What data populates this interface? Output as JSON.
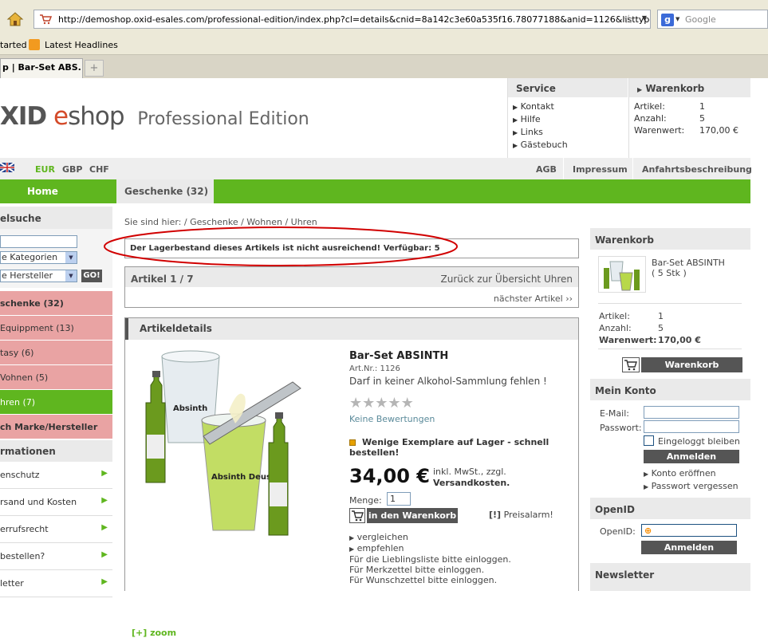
{
  "browser": {
    "url": "http://demoshop.oxid-esales.com/professional-edition/index.php?cl=details&cnid=8a142c3e60a535f16.78077188&anid=1126&listtype=list&&",
    "search_placeholder": "Google",
    "bookmarks": [
      "tarted",
      "Latest Headlines"
    ],
    "tab_title": "p | Bar-Set ABS...",
    "new_tab": "+"
  },
  "header": {
    "logo_oxid": "XID",
    "logo_e": "e",
    "logo_shop": "shop",
    "edition": "Professional Edition",
    "service": {
      "title": "Service",
      "links": [
        "Kontakt",
        "Hilfe",
        "Links",
        "Gästebuch"
      ]
    },
    "cart_top": {
      "title": "Warenkorb",
      "rows": [
        {
          "label": "Artikel:",
          "value": "1"
        },
        {
          "label": "Anzahl:",
          "value": "5"
        },
        {
          "label": "Warenwert:",
          "value": "170,00 €"
        }
      ]
    },
    "currencies": [
      "EUR",
      "GBP",
      "CHF"
    ],
    "toplinks": [
      "AGB",
      "Impressum",
      "Anfahrtsbeschreibung"
    ]
  },
  "nav": {
    "home": "Home",
    "active_category": "Geschenke (32)"
  },
  "sidebar": {
    "search_title": "elsuche",
    "category_select": "e Kategorien",
    "vendor_select": "e Hersteller",
    "go": "GO!",
    "categories": [
      "schenke (32)",
      "Equippment (13)",
      "tasy (6)",
      "Vohnen (5)",
      "hren (7)",
      "ch Marke/Hersteller"
    ],
    "info_title": "rmationen",
    "info_links": [
      "enschutz",
      "rsand und Kosten",
      "errufsrecht",
      "bestellen?",
      "letter"
    ]
  },
  "breadcrumb": {
    "prefix": "Sie sind hier:",
    "trail": "/ Geschenke / Wohnen / Uhren"
  },
  "notice": "Der Lagerbestand dieses Artikels ist nicht ausreichend! Verfügbar: 5",
  "pager": {
    "position": "Artikel 1 / 7",
    "back": "Zurück zur Übersicht Uhren",
    "next": "nächster Artikel"
  },
  "details": {
    "title": "Artikeldetails",
    "product_name": "Bar-Set ABSINTH",
    "art_nr": "Art.Nr.: 1126",
    "short_desc": "Darf in keiner Alkohol-Sammlung fehlen !",
    "stars_filled": 0,
    "stars_total": 5,
    "reviews": "Keine Bewertungen",
    "stock_msg": "Wenige Exemplare auf Lager - schnell bestellen!",
    "price": "34,00 €",
    "tax_note": "inkl. MwSt., zzgl.",
    "shipping": "Versandkosten.",
    "qty_label": "Menge:",
    "qty_value": "1",
    "add_to_cart": "in den Warenkorb",
    "price_alarm_tag": "[!]",
    "price_alarm": "Preisalarm!",
    "zoom": "[+] zoom",
    "compare": "vergleichen",
    "recommend": "empfehlen",
    "login_notes": [
      "Für die Lieblingsliste bitte einloggen.",
      "Für Merkzettel bitte einloggen.",
      "Für Wunschzettel bitte einloggen."
    ],
    "image_labels": [
      "Absinth",
      "Absinth Deus"
    ]
  },
  "right": {
    "cart": {
      "title": "Warenkorb",
      "item_name": "Bar-Set ABSINTH",
      "item_qty": "( 5 Stk )",
      "rows": [
        {
          "label": "Artikel:",
          "value": "1"
        },
        {
          "label": "Anzahl:",
          "value": "5"
        },
        {
          "label": "Warenwert:",
          "value": "170,00 €"
        }
      ],
      "show_button": "Warenkorb anzeigen"
    },
    "account": {
      "title": "Mein Konto",
      "email_label": "E-Mail:",
      "password_label": "Passwort:",
      "remember": "Eingeloggt bleiben",
      "login_button": "Anmelden",
      "links": [
        "Konto eröffnen",
        "Passwort vergessen"
      ]
    },
    "openid": {
      "title": "OpenID",
      "label": "OpenID:",
      "button": "Anmelden"
    },
    "newsletter": {
      "title": "Newsletter"
    }
  },
  "colors": {
    "accent": "#5fb61f",
    "category_pink": "#e9a3a3",
    "annotation_red": "#d10000"
  }
}
